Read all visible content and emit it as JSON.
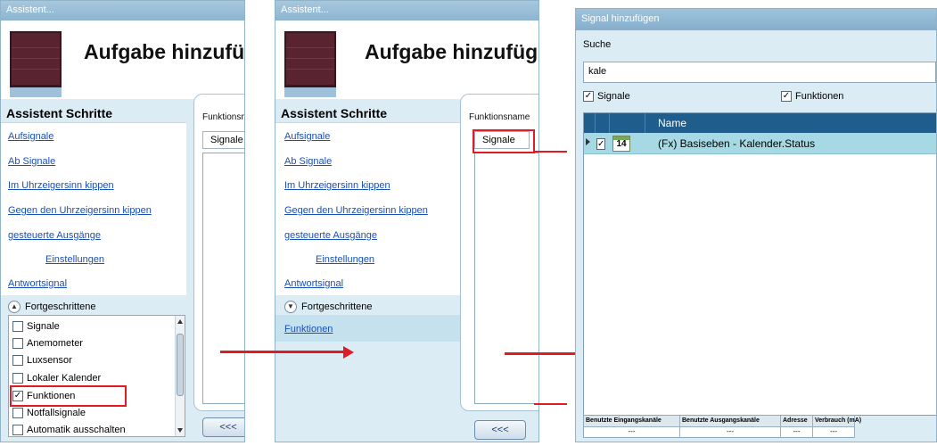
{
  "wizard": {
    "window_title": "Assistent...",
    "task_title": "Aufgabe hinzufügen",
    "steps_title": "Assistent Schritte",
    "steps": [
      "Aufsignale",
      "Ab Signale",
      "Im Uhrzeigersinn kippen",
      "Gegen den Uhrzeigersinn kippen",
      "gesteuerte Ausgänge",
      "Einstellungen",
      "Antwortsignal"
    ],
    "advanced_label": "Fortgeschrittene",
    "advanced_items": [
      {
        "label": "Signale",
        "checked": false
      },
      {
        "label": "Anemometer",
        "checked": false
      },
      {
        "label": "Luxsensor",
        "checked": false
      },
      {
        "label": "Lokaler Kalender",
        "checked": false
      },
      {
        "label": "Funktionen",
        "checked": true
      },
      {
        "label": "Notfallsignale",
        "checked": false
      },
      {
        "label": "Automatik ausschalten",
        "checked": false
      }
    ],
    "functions_step": "Funktionen",
    "function_name_label": "Funktionsname",
    "signals_tab": "Signale",
    "back_button": "<<<"
  },
  "dialog": {
    "title": "Signal hinzufügen",
    "search_label": "Suche",
    "search_value": "kale",
    "filter_signals": "Signale",
    "filter_functions": "Funktionen",
    "column_name": "Name",
    "rows": [
      {
        "calendar_day": "14",
        "name": "(Fx) Basiseben - Kalender.Status"
      }
    ],
    "stats_headers": [
      "Benutzte Eingangskanäle",
      "Benutzte Ausgangskanäle",
      "Adresse",
      "Verbrauch (mA)"
    ],
    "stats_values": [
      "---",
      "---",
      "---",
      "---"
    ]
  },
  "colors": {
    "highlight_red": "#e01b24",
    "grid_header": "#1f5d8c",
    "selected_row": "#a6d9e4",
    "link_blue": "#1a4fb5"
  }
}
